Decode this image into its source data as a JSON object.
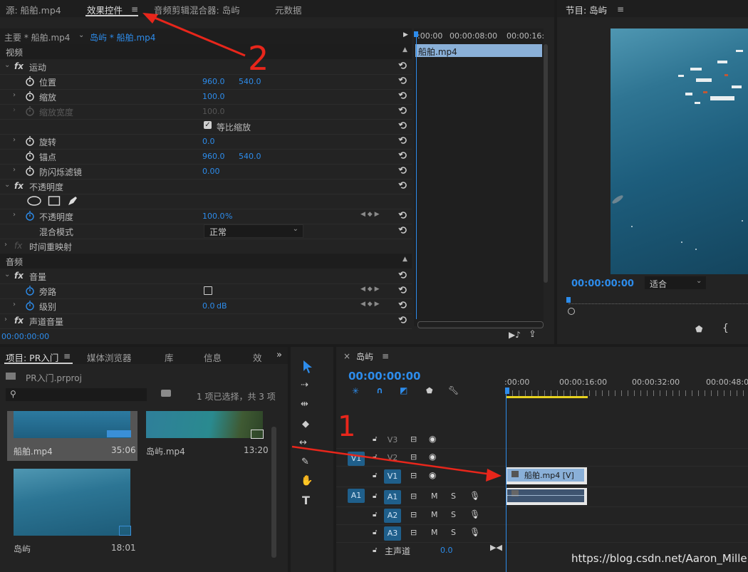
{
  "effect_controls": {
    "tabs": [
      "源: 船舶.mp4",
      "效果控件",
      "音频剪辑混合器: 岛屿",
      "元数据"
    ],
    "menu_icon": "hamburger-icon",
    "master_label": "主要 * 船舶.mp4",
    "clip_label": "岛屿 * 船舶.mp4",
    "timecodes": [
      ":00:00",
      "00:00:08:00",
      "00:00:16:"
    ],
    "clip_bar_label": "船舶.mp4",
    "video_header": "视频",
    "motion_label": "运动",
    "position_label": "位置",
    "position_x": "960.0",
    "position_y": "540.0",
    "scale_label": "缩放",
    "scale_value": "100.0",
    "scale_width_label": "缩放宽度",
    "scale_width_value": "100.0",
    "uniform_scale_label": "等比缩放",
    "rotation_label": "旋转",
    "rotation_value": "0.0",
    "anchor_label": "锚点",
    "anchor_x": "960.0",
    "anchor_y": "540.0",
    "flicker_label": "防闪烁滤镜",
    "flicker_value": "0.00",
    "opacity_group_label": "不透明度",
    "opacity_label": "不透明度",
    "opacity_value": "100.0",
    "opacity_unit": "%",
    "blend_label": "混合模式",
    "blend_value": "正常",
    "time_remap_label": "时间重映射",
    "audio_header": "音频",
    "volume_label": "音量",
    "bypass_label": "旁路",
    "level_label": "级别",
    "level_value": "0.0",
    "level_unit": "dB",
    "channel_volume_label": "声道音量",
    "footer_timecode": "00:00:00:00",
    "fx_label": "fx"
  },
  "program_monitor": {
    "title": "节目: 岛屿",
    "timecode": "00:00:00:00",
    "fit_label": "适合"
  },
  "project": {
    "tabs": [
      "项目: PR入门",
      "媒体浏览器",
      "库",
      "信息",
      "效"
    ],
    "file_name": "PR入门.prproj",
    "selection_status": "1 项已选择，共 3 项",
    "items": [
      {
        "name": "船舶.mp4",
        "duration": "35:06"
      },
      {
        "name": "岛屿.mp4",
        "duration": "13:20"
      },
      {
        "name": "岛屿",
        "duration": "18:01"
      }
    ]
  },
  "timeline": {
    "title": "岛屿",
    "timecode": "00:00:00:00",
    "ruler": [
      ":00:00",
      "00:00:16:00",
      "00:00:32:00",
      "00:00:48:00"
    ],
    "tracks": {
      "v3": "V3",
      "v2": "V2",
      "v1": "V1",
      "a1": "A1",
      "a2": "A2",
      "a3": "A3",
      "src_v": "V1",
      "src_a": "A1",
      "master_label": "主声道",
      "master_value": "0.0",
      "m_label": "M",
      "s_label": "S"
    },
    "video_clip_label": "船舶.mp4 [V]"
  },
  "annotations": {
    "label_2": "2",
    "label_1": "1",
    "arrow_color": "#e8261b"
  },
  "watermark": "https://blog.csdn.net/Aaron_Miller",
  "colors": {
    "accent": "#2d8ceb",
    "track_on": "#1f5f8b",
    "clip": "#8ab0d8",
    "work_area": "#e8d21f"
  }
}
